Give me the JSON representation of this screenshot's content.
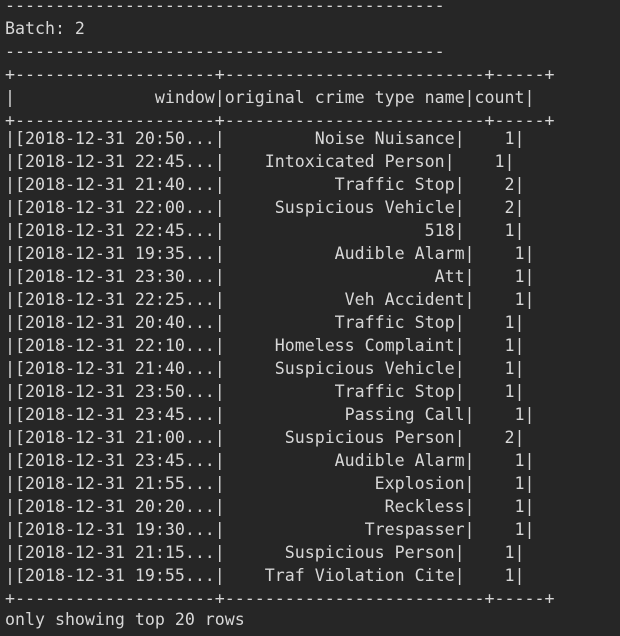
{
  "terminal": {
    "colors": {
      "background": "#262626",
      "foreground": "#d7d7d7"
    },
    "lines": [
      "--------------------------------------------",
      "Batch: 2",
      "--------------------------------------------",
      "+--------------------+--------------------------+-----+",
      "|              window|original crime type name|count|",
      "+--------------------+--------------------------+-----+",
      "|[2018-12-31 20:50...|         Noise Nuisance|    1|",
      "|[2018-12-31 22:45...|    Intoxicated Person|    1|",
      "|[2018-12-31 21:40...|           Traffic Stop|    2|",
      "|[2018-12-31 22:00...|     Suspicious Vehicle|    2|",
      "|[2018-12-31 22:45...|                    518|    1|",
      "|[2018-12-31 19:35...|           Audible Alarm|    1|",
      "|[2018-12-31 23:30...|                     Att|    1|",
      "|[2018-12-31 22:25...|            Veh Accident|    1|",
      "|[2018-12-31 20:40...|           Traffic Stop|    1|",
      "|[2018-12-31 22:10...|     Homeless Complaint|    1|",
      "|[2018-12-31 21:40...|     Suspicious Vehicle|    1|",
      "|[2018-12-31 23:50...|           Traffic Stop|    1|",
      "|[2018-12-31 23:45...|            Passing Call|    1|",
      "|[2018-12-31 21:00...|      Suspicious Person|    2|",
      "|[2018-12-31 23:45...|           Audible Alarm|    1|",
      "|[2018-12-31 21:55...|               Explosion|    1|",
      "|[2018-12-31 20:20...|                Reckless|    1|",
      "|[2018-12-31 19:30...|              Trespasser|    1|",
      "|[2018-12-31 21:15...|      Suspicious Person|    1|",
      "|[2018-12-31 19:55...|    Traf Violation Cite|    1|",
      "+--------------------+--------------------------+-----+",
      "only showing top 20 rows"
    ]
  }
}
